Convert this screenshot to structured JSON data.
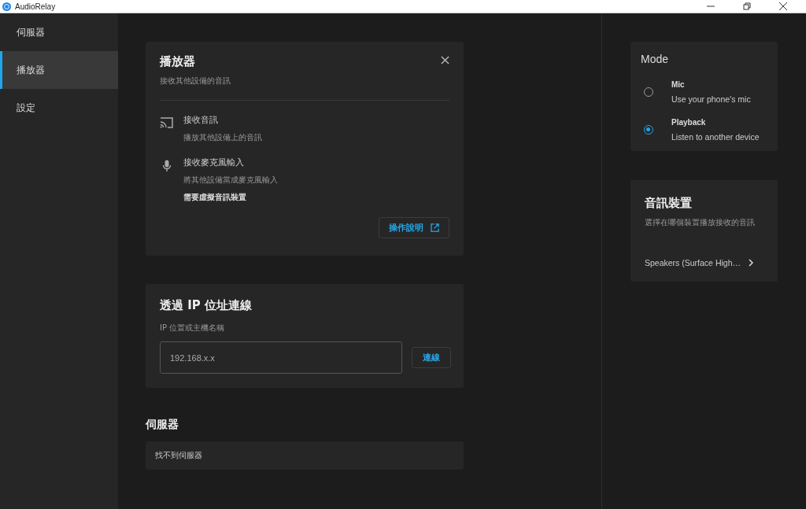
{
  "window": {
    "title": "AudioRelay"
  },
  "sidebar": {
    "items": [
      {
        "label": "伺服器",
        "selected": false
      },
      {
        "label": "播放器",
        "selected": true
      },
      {
        "label": "設定",
        "selected": false
      }
    ]
  },
  "player_card": {
    "title": "播放器",
    "subtitle": "接收其他設備的音訊",
    "features": [
      {
        "kind": "cast",
        "title": "接收音訊",
        "description": "播放其他設備上的音訊"
      },
      {
        "kind": "mic",
        "title": "接收麥克風輸入",
        "description": "將其他設備當成麥克風輸入",
        "note": "需要虛擬音訊裝置"
      }
    ],
    "help_button": "操作說明"
  },
  "ip_card": {
    "title": "透過 IP 位址連線",
    "field_label": "IP 位置或主機名稱",
    "placeholder": "192.168.x.x",
    "connect_button": "連線"
  },
  "servers": {
    "title": "伺服器",
    "empty_text": "找不到伺服器"
  },
  "mode": {
    "title": "Mode",
    "options": [
      {
        "label": "Mic",
        "description": "Use your phone's mic",
        "selected": false
      },
      {
        "label": "Playback",
        "description": "Listen to another device",
        "selected": true
      }
    ]
  },
  "audio_device": {
    "title": "音訊裝置",
    "description": "選擇在哪個裝置播放接收的音訊",
    "device": "Speakers (Surface High…"
  }
}
